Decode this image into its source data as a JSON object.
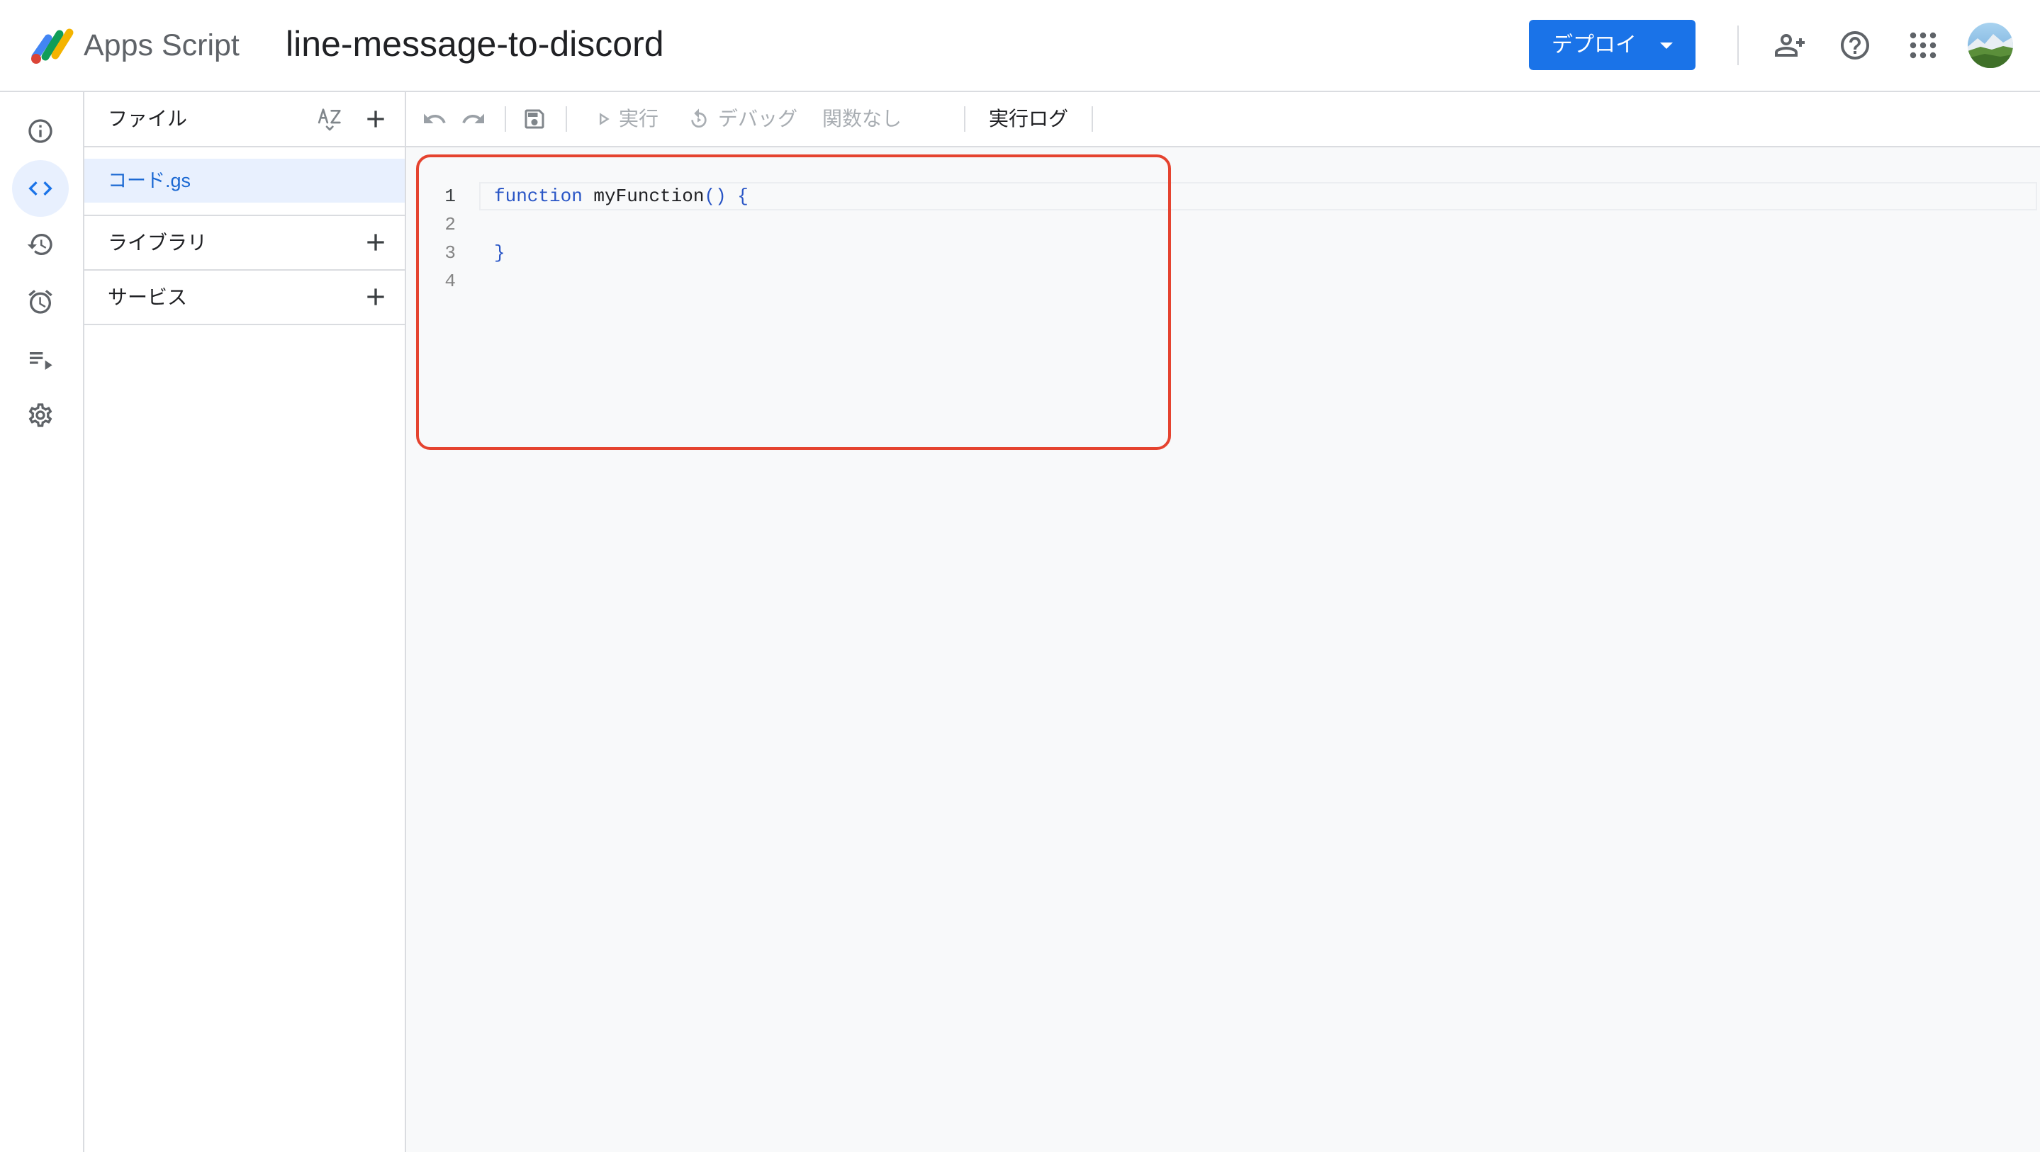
{
  "app": {
    "name": "Apps Script",
    "project_title": "line-message-to-discord",
    "logo_icon": "apps-script-logo"
  },
  "header": {
    "deploy_label": "デプロイ",
    "actions": [
      "person-add-icon",
      "help-icon",
      "apps-grid-icon",
      "avatar"
    ]
  },
  "rail": [
    {
      "icon": "info-icon"
    },
    {
      "icon": "code-icon",
      "active": true
    },
    {
      "icon": "history-icon"
    },
    {
      "icon": "alarm-icon"
    },
    {
      "icon": "playlist-play-icon"
    },
    {
      "icon": "settings-icon"
    }
  ],
  "files_panel": {
    "files_label": "ファイル",
    "sort_icon": "sort-az-icon",
    "add_icon": "add-icon",
    "files": [
      {
        "name": "コード.gs",
        "selected": true
      }
    ],
    "libraries_label": "ライブラリ",
    "services_label": "サービス"
  },
  "toolbar": {
    "icons": [
      "undo-icon",
      "redo-icon",
      "save-icon",
      "play-icon",
      "debug-icon"
    ],
    "run_label": "実行",
    "debug_label": "デバッグ",
    "function_select": "関数なし",
    "execution_log_label": "実行ログ"
  },
  "editor": {
    "lines": [
      {
        "number": "1",
        "current": true,
        "tokens": [
          {
            "text": "function",
            "color": "#2a56c6"
          },
          {
            "text": " myFunction",
            "color": "#202124"
          },
          {
            "text": "()",
            "color": "#2a56c6"
          },
          {
            "text": " {",
            "color": "#2a56c6"
          }
        ]
      },
      {
        "number": "2",
        "tokens": []
      },
      {
        "number": "3",
        "tokens": [
          {
            "text": "}",
            "color": "#2a56c6"
          }
        ]
      },
      {
        "number": "4",
        "tokens": []
      }
    ]
  },
  "colors": {
    "accent": "#1a73e8",
    "selected_bg": "#e8f0fe",
    "selected_text": "#1967d2",
    "annotation": "#e5432f"
  }
}
